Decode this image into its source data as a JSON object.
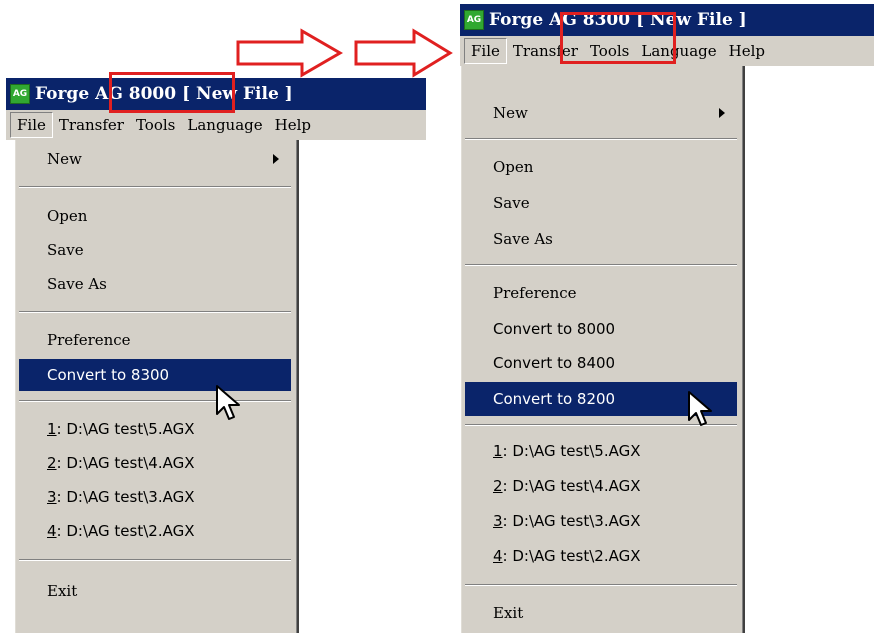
{
  "left": {
    "title_app": "Forge",
    "title_model": "AG 8000",
    "title_file": "[ New File ]",
    "menubar": [
      "File",
      "Transfer",
      "Tools",
      "Language",
      "Help"
    ],
    "menu": {
      "new": "New",
      "open": "Open",
      "save": "Save",
      "save_as": "Save As",
      "preference": "Preference",
      "convert": [
        "Convert to 8300"
      ],
      "recent": [
        {
          "num": "1",
          "path": ": D:\\AG test\\5.AGX"
        },
        {
          "num": "2",
          "path": ": D:\\AG test\\4.AGX"
        },
        {
          "num": "3",
          "path": ": D:\\AG test\\3.AGX"
        },
        {
          "num": "4",
          "path": ": D:\\AG test\\2.AGX"
        }
      ],
      "exit": "Exit"
    }
  },
  "right": {
    "title_app": "Forge",
    "title_model": "AG 8300",
    "title_file": "[ New File ]",
    "menubar": [
      "File",
      "Transfer",
      "Tools",
      "Language",
      "Help"
    ],
    "menu": {
      "new": "New",
      "open": "Open",
      "save": "Save",
      "save_as": "Save As",
      "preference": "Preference",
      "convert": [
        "Convert to 8000",
        "Convert to 8400",
        "Convert to 8200"
      ],
      "recent": [
        {
          "num": "1",
          "path": ": D:\\AG test\\5.AGX"
        },
        {
          "num": "2",
          "path": ": D:\\AG test\\4.AGX"
        },
        {
          "num": "3",
          "path": ": D:\\AG test\\3.AGX"
        },
        {
          "num": "4",
          "path": ": D:\\AG test\\2.AGX"
        }
      ],
      "exit": "Exit"
    }
  },
  "app_icon_label": "AG",
  "icons": [
    "right-arrow-icon",
    "right-arrow-icon",
    "pointer-cursor-icon",
    "pointer-cursor-icon",
    "submenu-arrow-icon"
  ],
  "colors": {
    "title_bg": "#0a246a",
    "menu_bg": "#d4d0c8",
    "highlight": "#0a246a",
    "annotation": "#e02020",
    "app_icon": "#31a831"
  }
}
